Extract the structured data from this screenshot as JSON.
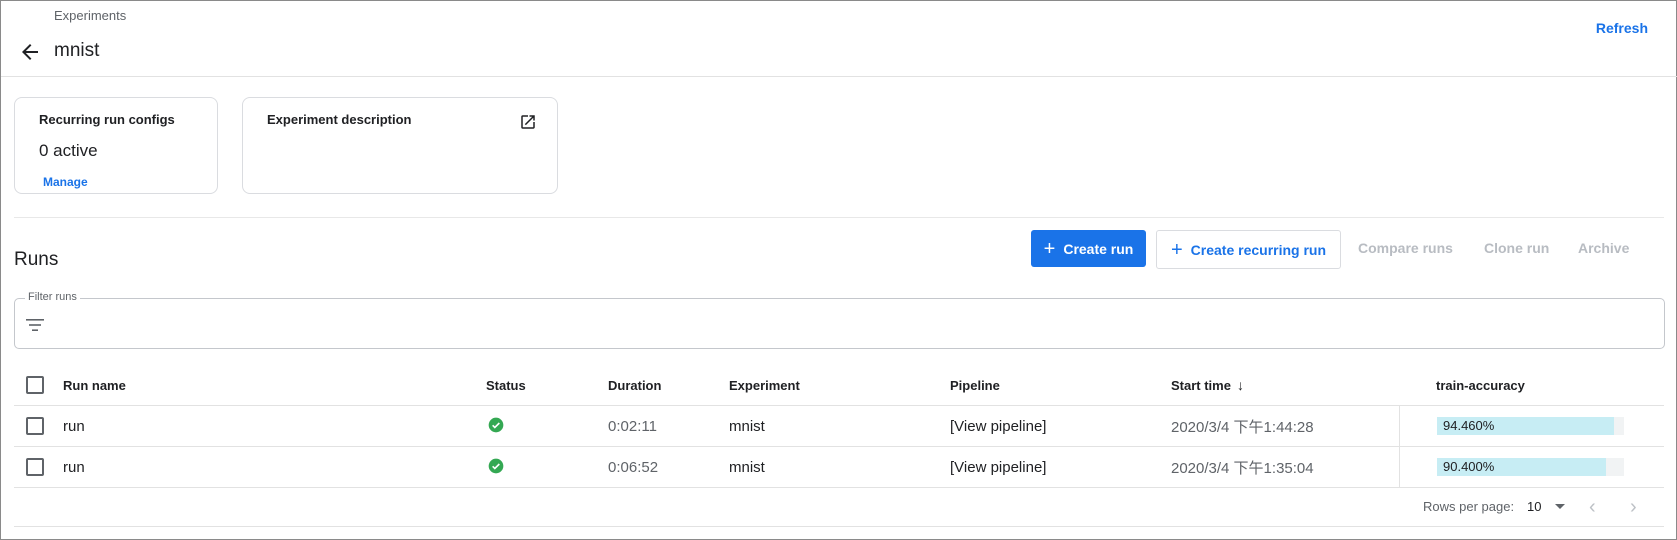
{
  "header": {
    "breadcrumb": "Experiments",
    "title": "mnist",
    "refresh_label": "Refresh"
  },
  "cards": {
    "recurring": {
      "title": "Recurring run configs",
      "value": "0 active",
      "manage_label": "Manage"
    },
    "description": {
      "title": "Experiment description"
    }
  },
  "runs": {
    "title": "Runs",
    "toolbar": {
      "create_run": "Create run",
      "create_recurring_run": "Create recurring run",
      "compare_runs": "Compare runs",
      "clone_run": "Clone run",
      "archive": "Archive"
    },
    "filter": {
      "label": "Filter runs"
    },
    "columns": {
      "run_name": "Run name",
      "status": "Status",
      "duration": "Duration",
      "experiment": "Experiment",
      "pipeline": "Pipeline",
      "start_time": "Start time",
      "train_accuracy": "train-accuracy"
    },
    "rows": [
      {
        "run_name": "run",
        "status": "succeeded",
        "duration": "0:02:11",
        "experiment": "mnist",
        "pipeline": "[View pipeline]",
        "start_time": "2020/3/4 下午1:44:28",
        "train_accuracy": "94.460%",
        "accuracy_value": 0.9446
      },
      {
        "run_name": "run",
        "status": "succeeded",
        "duration": "0:06:52",
        "experiment": "mnist",
        "pipeline": "[View pipeline]",
        "start_time": "2020/3/4 下午1:35:04",
        "train_accuracy": "90.400%",
        "accuracy_value": 0.904
      }
    ],
    "pagination": {
      "rows_per_page_label": "Rows per page:",
      "rows_per_page_value": "10"
    }
  },
  "colors": {
    "accent": "#1a73e8",
    "success": "#34a853",
    "accuracy_fill": "#c7edf4"
  }
}
